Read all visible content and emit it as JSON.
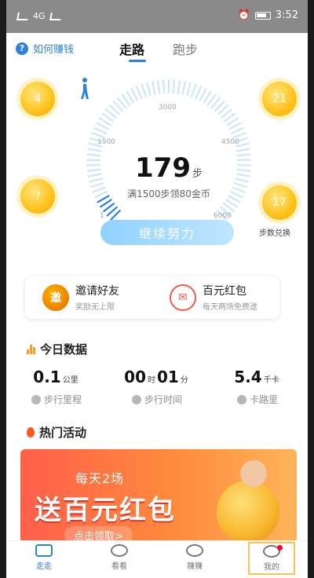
{
  "status_bar": {
    "network": "4G",
    "time": "3:52",
    "battery": ""
  },
  "top_nav": {
    "help_label": "如何赚钱",
    "tabs": [
      {
        "label": "走路",
        "active": true
      },
      {
        "label": "跑步",
        "active": false
      }
    ]
  },
  "gauge": {
    "ticks": [
      "1",
      "1500",
      "3000",
      "4500",
      "6000"
    ],
    "max_steps": 6000,
    "current_steps": 179,
    "steps_value": "179",
    "steps_unit": "步",
    "tip": "满1500步领80金币"
  },
  "coins": {
    "top_left": "4",
    "mid_left": "?",
    "top_right": "21",
    "mid_right": "17",
    "mid_right_label": "步数兑换"
  },
  "continue_button": "继续努力",
  "promo": {
    "invite": {
      "icon_char": "邀",
      "title": "邀请好友",
      "subtitle": "奖励无上限"
    },
    "redpacket": {
      "title": "百元红包",
      "subtitle": "每天两场免费送"
    }
  },
  "today": {
    "title": "今日数据",
    "distance": {
      "value": "0.1",
      "unit": "公里",
      "label": "步行里程"
    },
    "time": {
      "hours": "00",
      "hours_unit": "时",
      "minutes": "01",
      "minutes_unit": "分",
      "label": "步行时间"
    },
    "calories": {
      "value": "5.4",
      "unit": "千卡",
      "label": "卡路里"
    }
  },
  "hot": {
    "title": "热门活动",
    "banner_sub": "每天2场",
    "banner_main": "送百元红包",
    "banner_button": "点击领取>"
  },
  "bottom_nav": [
    {
      "label": "走走",
      "icon": "shoe-icon"
    },
    {
      "label": "看看",
      "icon": "eye-icon"
    },
    {
      "label": "赚赚",
      "icon": "eye-icon"
    },
    {
      "label": "我的",
      "icon": "face-icon"
    }
  ],
  "colors": {
    "accent": "#2d7fe0",
    "coin": "#ffc21a",
    "banner": "#ff6a45"
  }
}
